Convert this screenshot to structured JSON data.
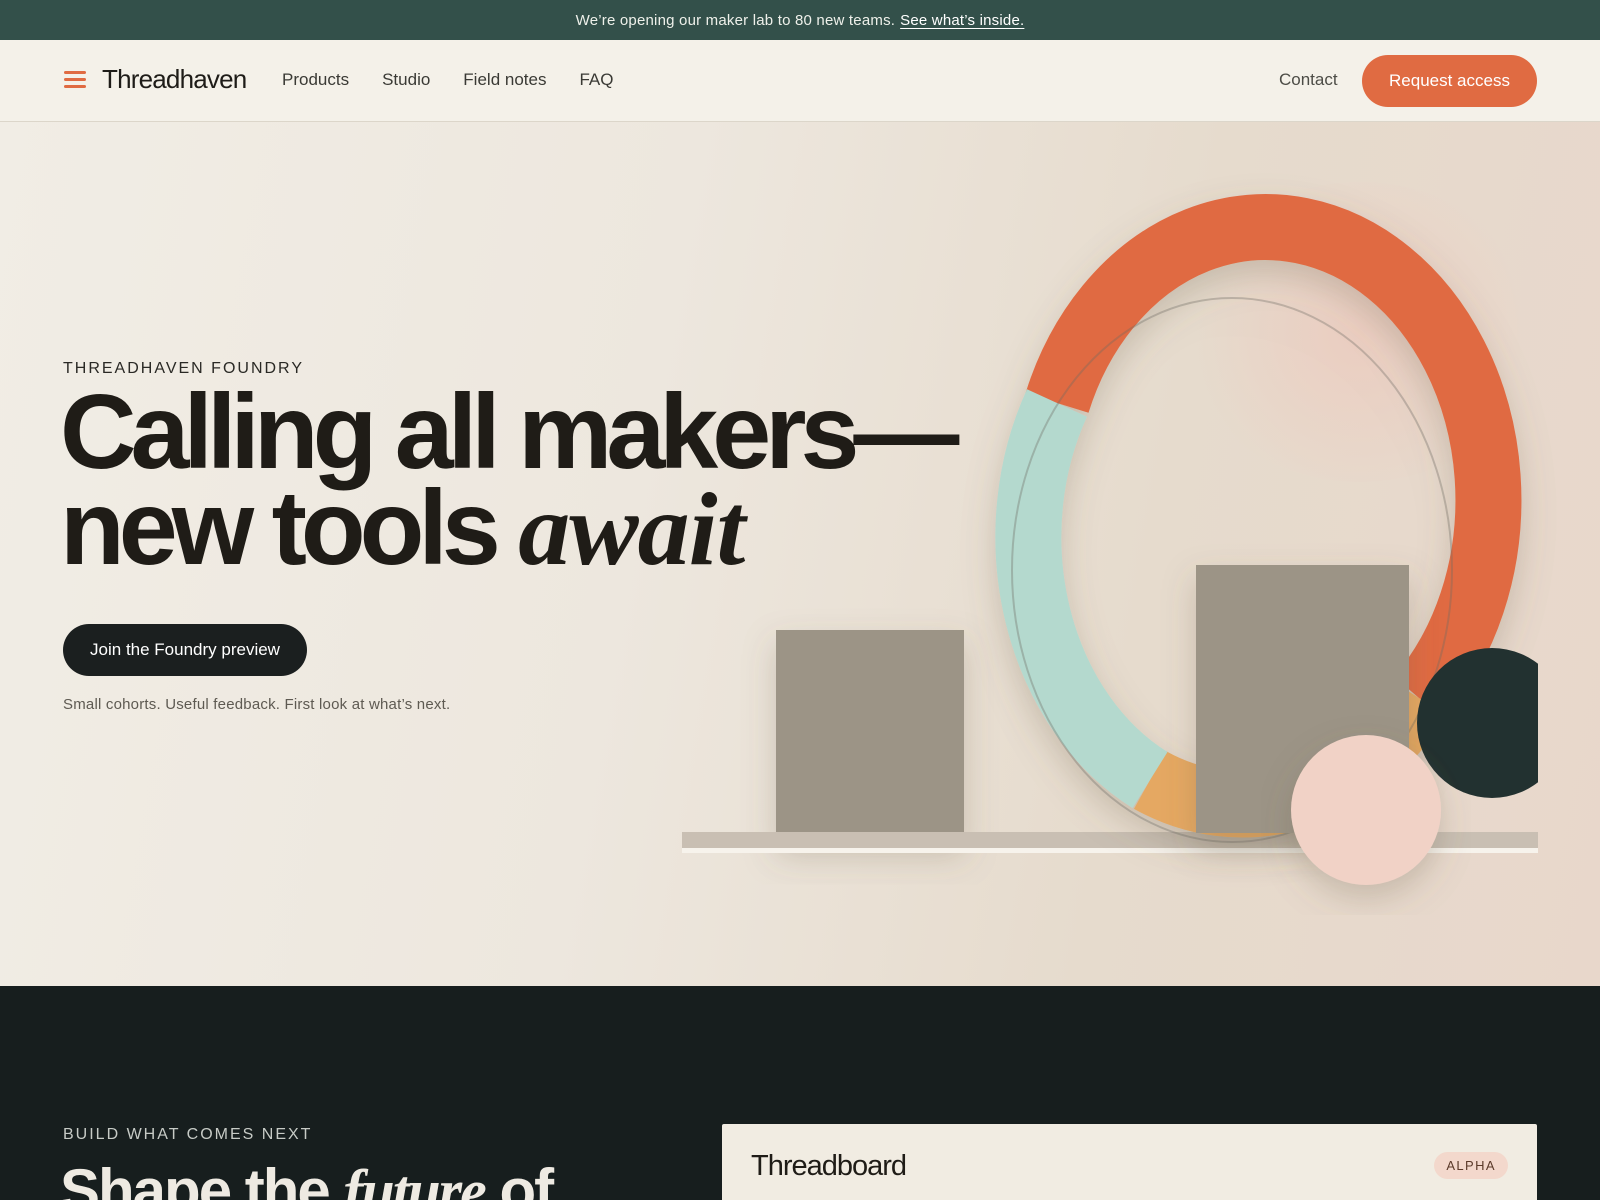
{
  "announcement": {
    "text": "We’re opening our maker lab to 80 new teams.",
    "link": "See what’s inside."
  },
  "header": {
    "brand": "Threadhaven",
    "nav": [
      "Products",
      "Studio",
      "Field notes",
      "FAQ"
    ],
    "contact": "Contact",
    "cta": "Request access"
  },
  "hero": {
    "eyebrow": "THREADHAVEN FOUNDRY",
    "headline_line1": "Calling all makers—",
    "headline_line2_regular": "new tools ",
    "headline_line2_italic": "await",
    "cta": "Join the Foundry preview",
    "subtext": "Small cohorts. Useful feedback. First look at what’s next."
  },
  "next_section": {
    "eyebrow": "BUILD WHAT COMES NEXT",
    "heading_regular": "Shape the ",
    "heading_italic": "future",
    "heading_end": " of",
    "card": {
      "title": "Threadboard",
      "badge": "ALPHA"
    }
  },
  "colors": {
    "announcement_bg": "#33504a",
    "accent": "#e06b42",
    "dark_bg": "#171e1e",
    "header_bg": "#f4f1e9",
    "ring_orange": "#e06b42",
    "ring_mint": "#b4d9ce",
    "ring_amber": "#e5a862",
    "block_taupe": "#9c9486",
    "circle_dark": "#223130",
    "circle_pink": "#f1d2c6"
  }
}
